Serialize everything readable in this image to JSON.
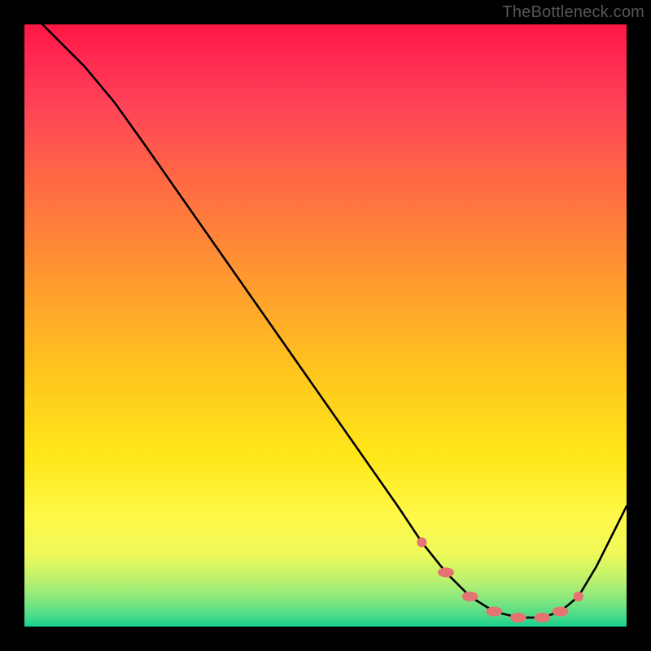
{
  "attribution": "TheBottleneck.com",
  "chart_data": {
    "type": "line",
    "title": "",
    "xlabel": "",
    "ylabel": "",
    "xlim": [
      0,
      100
    ],
    "ylim": [
      0,
      100
    ],
    "series": [
      {
        "name": "curve",
        "x": [
          3,
          10,
          15,
          20,
          27,
          34,
          41,
          48,
          55,
          62,
          66,
          70,
          74,
          78,
          82,
          86,
          89,
          92,
          95,
          100
        ],
        "y": [
          100,
          93,
          87,
          80,
          70,
          60,
          50,
          40,
          30,
          20,
          14,
          9,
          5,
          2.5,
          1.5,
          1.5,
          2.5,
          5,
          10,
          20
        ]
      }
    ],
    "markers": {
      "name": "flat-region",
      "x": [
        66,
        70,
        74,
        78,
        82,
        86,
        89,
        92
      ],
      "y": [
        14,
        9,
        5,
        2.5,
        1.5,
        1.5,
        2.5,
        5
      ]
    },
    "gradient_stops": [
      {
        "pos": 0,
        "color": "#ff1744"
      },
      {
        "pos": 14,
        "color": "#ff4557"
      },
      {
        "pos": 42,
        "color": "#ff9830"
      },
      {
        "pos": 72,
        "color": "#ffe81a"
      },
      {
        "pos": 92,
        "color": "#bff26c"
      },
      {
        "pos": 100,
        "color": "#18d18f"
      }
    ]
  }
}
